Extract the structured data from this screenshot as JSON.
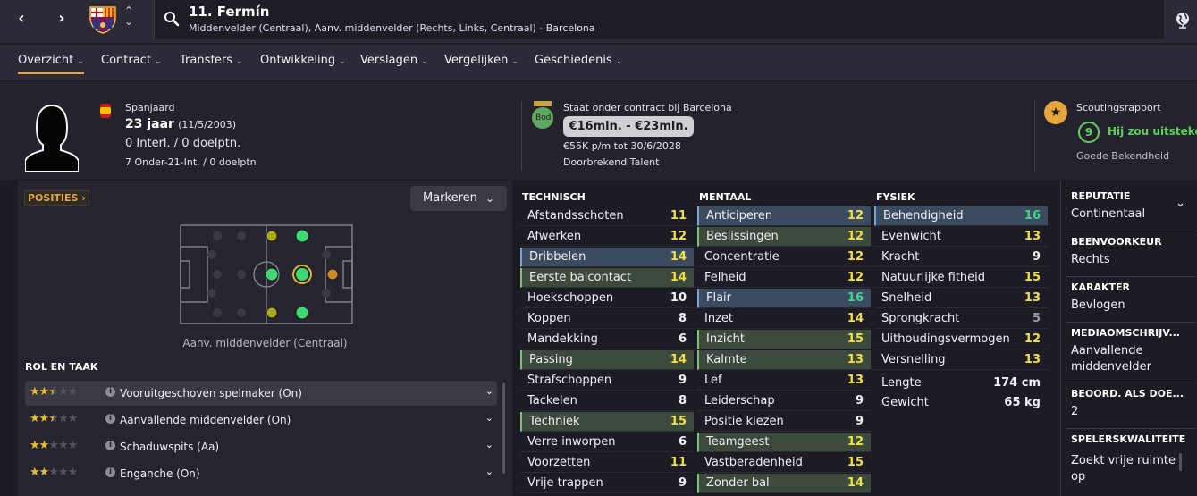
{
  "nav": {
    "back": "‹",
    "forward": "›"
  },
  "player": {
    "name": "11. Fermín",
    "subtitle": "Middenvelder (Centraal), Aanv. middenvelder (Rechts, Links, Centraal) - Barcelona"
  },
  "tabs": [
    {
      "label": "Overzicht",
      "active": true
    },
    {
      "label": "Contract"
    },
    {
      "label": "Transfers"
    },
    {
      "label": "Ontwikkeling"
    },
    {
      "label": "Verslagen"
    },
    {
      "label": "Vergelijken"
    },
    {
      "label": "Geschiedenis"
    }
  ],
  "info": {
    "nationality": "Spanjaard",
    "age": "23 jaar",
    "dob": "(11/5/2003)",
    "caps": "0 Interl. / 0 doelptn.",
    "u21": "7 Onder-21-Int. / 0 doelptn"
  },
  "contract": {
    "status": "Staat onder contract bij Barcelona",
    "bod": "Bod",
    "value": "€16mln. - €23mln.",
    "wage": "€55K p/m tot 30/6/2028",
    "tag": "Doorbrekend Talent"
  },
  "scouting": {
    "title": "Scoutingsrapport",
    "score": "9",
    "verdict": "Hij zou uitsteken",
    "knowledge": "Goede Bekendheid"
  },
  "positions": {
    "button": "POSITIES",
    "markeren": "Markeren",
    "label": "Aanv. middenvelder (Centraal)"
  },
  "roles": {
    "title": "ROL EN TAAK",
    "items": [
      {
        "label": "Vooruitgeschoven spelmaker (On)",
        "stars": 2.5
      },
      {
        "label": "Aanvallende middenvelder (On)",
        "stars": 2.5
      },
      {
        "label": "Schaduwspits (Aa)",
        "stars": 2
      },
      {
        "label": "Enganche (On)",
        "stars": 2
      }
    ]
  },
  "technical": {
    "title": "TECHNISCH",
    "rows": [
      {
        "name": "Afstandsschoten",
        "value": "11",
        "hl": ""
      },
      {
        "name": "Afwerken",
        "value": "12",
        "hl": ""
      },
      {
        "name": "Dribbelen",
        "value": "14",
        "hl": "b"
      },
      {
        "name": "Eerste balcontact",
        "value": "14",
        "hl": "g"
      },
      {
        "name": "Hoekschoppen",
        "value": "10",
        "hl": ""
      },
      {
        "name": "Koppen",
        "value": "8",
        "hl": ""
      },
      {
        "name": "Mandekking",
        "value": "6",
        "hl": ""
      },
      {
        "name": "Passing",
        "value": "14",
        "hl": "g"
      },
      {
        "name": "Strafschoppen",
        "value": "9",
        "hl": ""
      },
      {
        "name": "Tackelen",
        "value": "8",
        "hl": ""
      },
      {
        "name": "Techniek",
        "value": "15",
        "hl": "g"
      },
      {
        "name": "Verre inworpen",
        "value": "6",
        "hl": ""
      },
      {
        "name": "Voorzetten",
        "value": "11",
        "hl": ""
      },
      {
        "name": "Vrije trappen",
        "value": "9",
        "hl": ""
      }
    ]
  },
  "mental": {
    "title": "MENTAAL",
    "rows": [
      {
        "name": "Anticiperen",
        "value": "12",
        "hl": "b"
      },
      {
        "name": "Beslissingen",
        "value": "12",
        "hl": "g"
      },
      {
        "name": "Concentratie",
        "value": "12",
        "hl": ""
      },
      {
        "name": "Felheid",
        "value": "12",
        "hl": ""
      },
      {
        "name": "Flair",
        "value": "16",
        "hl": "b"
      },
      {
        "name": "Inzet",
        "value": "14",
        "hl": ""
      },
      {
        "name": "Inzicht",
        "value": "15",
        "hl": "g"
      },
      {
        "name": "Kalmte",
        "value": "13",
        "hl": "g"
      },
      {
        "name": "Lef",
        "value": "13",
        "hl": ""
      },
      {
        "name": "Leiderschap",
        "value": "9",
        "hl": ""
      },
      {
        "name": "Positie kiezen",
        "value": "9",
        "hl": ""
      },
      {
        "name": "Teamgeest",
        "value": "12",
        "hl": "g"
      },
      {
        "name": "Vastberadenheid",
        "value": "15",
        "hl": ""
      },
      {
        "name": "Zonder bal",
        "value": "14",
        "hl": "g"
      }
    ]
  },
  "physical": {
    "title": "FYSIEK",
    "rows": [
      {
        "name": "Behendigheid",
        "value": "16",
        "hl": "b"
      },
      {
        "name": "Evenwicht",
        "value": "13",
        "hl": ""
      },
      {
        "name": "Kracht",
        "value": "9",
        "hl": ""
      },
      {
        "name": "Natuurlijke fitheid",
        "value": "15",
        "hl": ""
      },
      {
        "name": "Snelheid",
        "value": "13",
        "hl": ""
      },
      {
        "name": "Sprongkracht",
        "value": "5",
        "hl": ""
      },
      {
        "name": "Uithoudingsvermogen",
        "value": "12",
        "hl": ""
      },
      {
        "name": "Versnelling",
        "value": "13",
        "hl": ""
      }
    ],
    "height_label": "Lengte",
    "height": "174 cm",
    "weight_label": "Gewicht",
    "weight": "65 kg"
  },
  "sidebar": [
    {
      "title": "REPUTATIE",
      "value": "Continentaal"
    },
    {
      "title": "BEENVOORKEUR",
      "value": "Rechts"
    },
    {
      "title": "KARAKTER",
      "value": "Bevlogen"
    },
    {
      "title": "MEDIAOMSCHRIJV...",
      "value": "Aanvallende middenvelder"
    },
    {
      "title": "BEOORD. ALS DOE...",
      "value": "2"
    },
    {
      "title": "SPELERSKWALITEITE",
      "value": "Zoekt vrije ruimte op"
    }
  ],
  "colors": {
    "accent": "#e6a63c",
    "green": "#3fd88a",
    "yellow": "#f2e04a",
    "blue_hl": "#3b4c61",
    "green_hl": "#3c4a3c"
  }
}
